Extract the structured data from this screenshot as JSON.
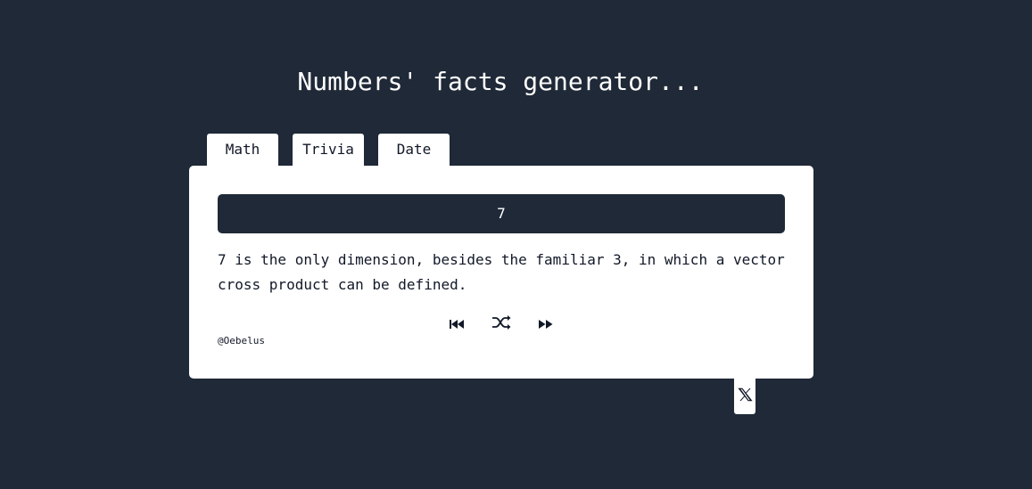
{
  "header": {
    "title": "Numbers' facts generator..."
  },
  "tabs": [
    {
      "label": "Math"
    },
    {
      "label": "Trivia"
    },
    {
      "label": "Date"
    }
  ],
  "card": {
    "number": "7",
    "fact": "7 is the only dimension, besides the familiar 3, in which a vector cross product can be defined.",
    "credit": "@Oebelus",
    "controls": [
      {
        "icon": "skip-previous-icon"
      },
      {
        "icon": "shuffle-icon"
      },
      {
        "icon": "fast-forward-icon"
      }
    ]
  },
  "share": {
    "icon": "x-logo-icon"
  },
  "colors": {
    "background": "#1f2937",
    "card": "#ffffff",
    "text": "#111827"
  }
}
